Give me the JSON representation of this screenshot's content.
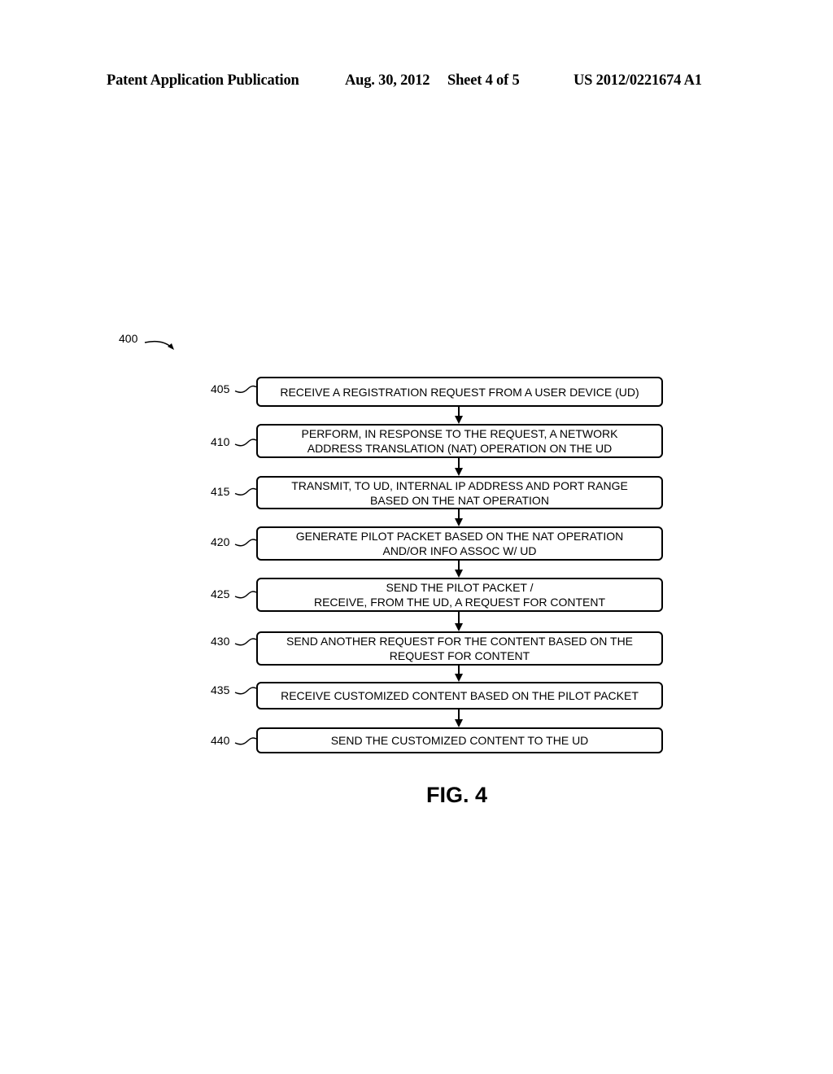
{
  "header": {
    "publication": "Patent Application Publication",
    "date": "Aug. 30, 2012",
    "sheet": "Sheet 4 of 5",
    "number": "US 2012/0221674 A1"
  },
  "figure": {
    "ref": "400",
    "caption": "FIG. 4",
    "steps": [
      {
        "ref": "405",
        "lines": [
          "RECEIVE A REGISTRATION REQUEST FROM A USER DEVICE (UD)"
        ]
      },
      {
        "ref": "410",
        "lines": [
          "PERFORM, IN RESPONSE TO THE REQUEST, A NETWORK",
          "ADDRESS TRANSLATION (NAT) OPERATION ON THE UD"
        ]
      },
      {
        "ref": "415",
        "lines": [
          "TRANSMIT, TO UD, INTERNAL IP ADDRESS AND PORT RANGE",
          "BASED ON THE NAT OPERATION"
        ]
      },
      {
        "ref": "420",
        "lines": [
          "GENERATE PILOT PACKET BASED ON THE NAT OPERATION",
          "AND/OR INFO ASSOC W/ UD"
        ]
      },
      {
        "ref": "425",
        "lines": [
          "SEND THE PILOT PACKET /",
          "RECEIVE, FROM THE UD, A REQUEST FOR CONTENT"
        ]
      },
      {
        "ref": "430",
        "lines": [
          "SEND ANOTHER REQUEST FOR THE CONTENT BASED ON THE",
          "REQUEST FOR CONTENT"
        ]
      },
      {
        "ref": "435",
        "lines": [
          "RECEIVE CUSTOMIZED CONTENT BASED ON THE PILOT PACKET"
        ]
      },
      {
        "ref": "440",
        "lines": [
          "SEND THE CUSTOMIZED CONTENT TO THE UD"
        ]
      }
    ]
  }
}
